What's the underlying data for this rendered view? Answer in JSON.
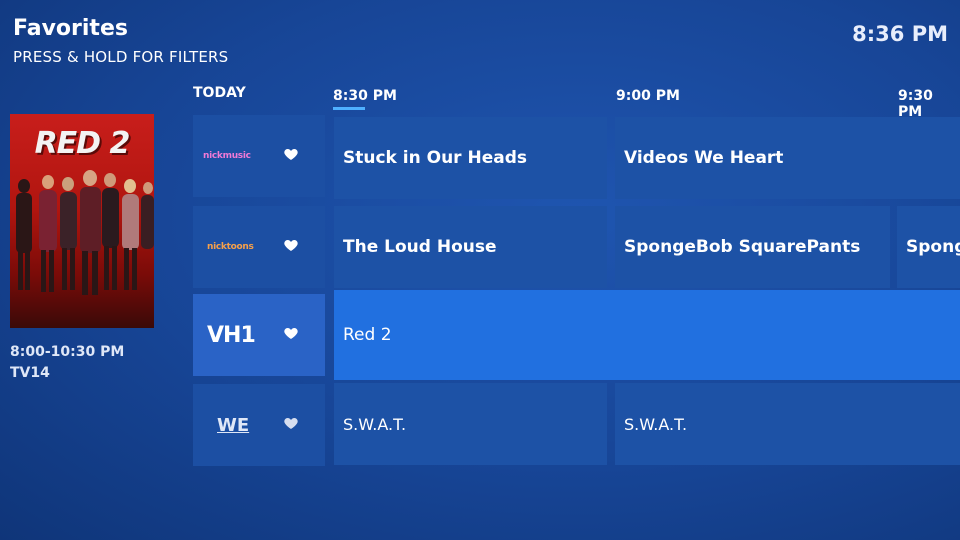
{
  "header": {
    "title": "Favorites",
    "subtitle": "PRESS & HOLD FOR FILTERS",
    "clock": "8:36 PM"
  },
  "preview": {
    "poster_title": "RED 2",
    "time_range": "8:00-10:30 PM",
    "rating": "TV14"
  },
  "timeline": {
    "day": "TODAY",
    "slots": [
      "8:30 PM",
      "9:00 PM",
      "9:30 PM"
    ]
  },
  "channels": [
    {
      "logo": "nickmusic",
      "favorite_icon": "heart-icon",
      "programs": [
        "Stuck in Our Heads",
        "Videos We Heart"
      ]
    },
    {
      "logo": "nicktoons",
      "favorite_icon": "heart-icon",
      "programs": [
        "The Loud House",
        "SpongeBob SquarePants",
        "Spong"
      ]
    },
    {
      "logo": "VH1",
      "favorite_icon": "heart-icon",
      "programs": [
        "Red 2"
      ]
    },
    {
      "logo": "WE",
      "favorite_icon": "heart-icon",
      "programs": [
        "S.W.A.T.",
        "S.W.A.T."
      ]
    }
  ],
  "colors": {
    "background": "#174596",
    "cell": "#1d52a6",
    "focused_cell": "#2170e0",
    "now_indicator": "#4fb0ff"
  }
}
